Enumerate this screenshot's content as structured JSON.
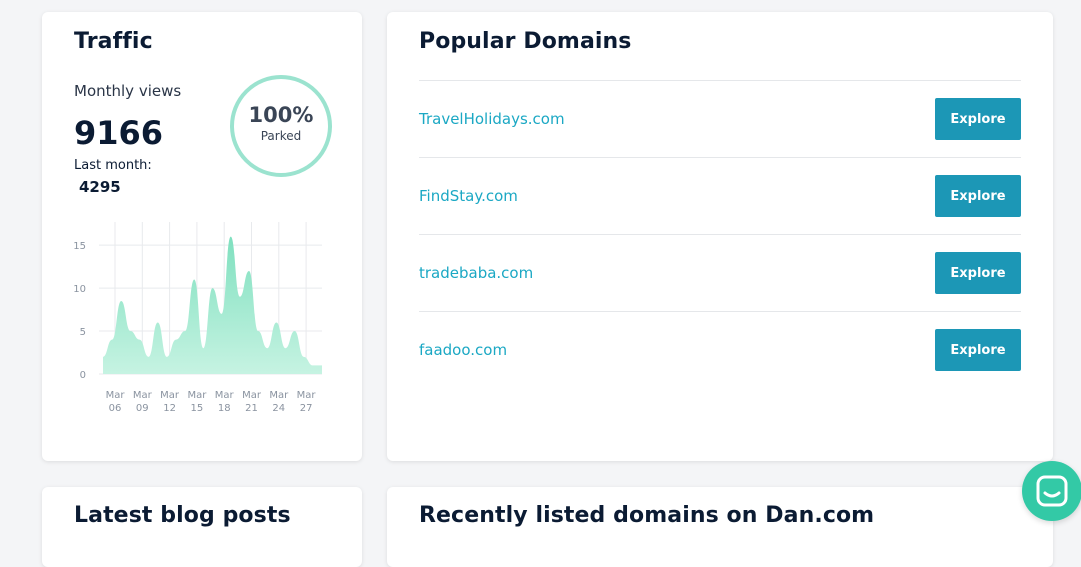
{
  "traffic": {
    "title": "Traffic",
    "monthly_label": "Monthly views",
    "monthly_value": "9166",
    "last_month_label": "Last month:",
    "last_month_value": "4295",
    "parked_value": "100%",
    "parked_label": "Parked"
  },
  "chart_data": {
    "type": "area",
    "title": "",
    "xlabel": "",
    "ylabel": "",
    "ylim": [
      0,
      17
    ],
    "y_ticks": [
      "0",
      "5",
      "10",
      "15"
    ],
    "x_tick_labels": [
      [
        "Mar",
        "06"
      ],
      [
        "Mar",
        "09"
      ],
      [
        "Mar",
        "12"
      ],
      [
        "Mar",
        "15"
      ],
      [
        "Mar",
        "18"
      ],
      [
        "Mar",
        "21"
      ],
      [
        "Mar",
        "24"
      ],
      [
        "Mar",
        "27"
      ]
    ],
    "x": [
      "Mar 04",
      "Mar 05",
      "Mar 06",
      "Mar 07",
      "Mar 08",
      "Mar 09",
      "Mar 10",
      "Mar 11",
      "Mar 12",
      "Mar 13",
      "Mar 14",
      "Mar 15",
      "Mar 16",
      "Mar 17",
      "Mar 18",
      "Mar 19",
      "Mar 20",
      "Mar 21",
      "Mar 22",
      "Mar 23",
      "Mar 24",
      "Mar 25",
      "Mar 26",
      "Mar 27",
      "Mar 28"
    ],
    "values": [
      2,
      4,
      8.5,
      5,
      4,
      2,
      6,
      2,
      4,
      5,
      11,
      3,
      10,
      7,
      16,
      9,
      12,
      5,
      3,
      6,
      3,
      5,
      2,
      1,
      1
    ],
    "grid": true,
    "fill_color": "#8ee6c8"
  },
  "domains": {
    "title": "Popular Domains",
    "items": [
      {
        "name": "TravelHolidays.com",
        "button": "Explore"
      },
      {
        "name": "FindStay.com",
        "button": "Explore"
      },
      {
        "name": "tradebaba.com",
        "button": "Explore"
      },
      {
        "name": "faadoo.com",
        "button": "Explore"
      }
    ]
  },
  "blog": {
    "title": "Latest blog posts"
  },
  "recent": {
    "title": "Recently listed domains on Dan.com"
  },
  "colors": {
    "accent": "#1c97b6",
    "link": "#1ba8c4",
    "ring": "#9be3cf",
    "chat": "#33c9a6"
  },
  "icons": {
    "chat": "chat-bubble-icon"
  }
}
